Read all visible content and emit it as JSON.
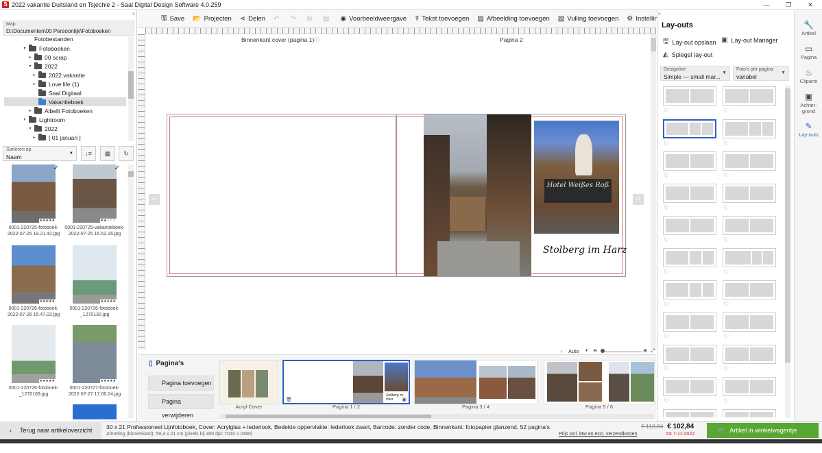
{
  "window": {
    "title": "2022 vakantie Duitsland en Tsjechie 2 - Saal Digital Design Software 4.0.259",
    "logo": "S",
    "min": "—",
    "max": "❐",
    "close": "✕"
  },
  "left": {
    "map_label": "Map",
    "map_path": "D:\\Documenten\\00 Persoonlijk\\Fotoboeken",
    "tree": [
      {
        "label": "Fotobestanden",
        "arrow": "",
        "folder": false
      },
      {
        "label": "Fotoboeken",
        "arrow": "▾",
        "folder": true
      },
      {
        "label": "00 scrap",
        "arrow": "▸",
        "folder": true
      },
      {
        "label": "2022",
        "arrow": "▾",
        "folder": true
      },
      {
        "label": "2022 vakantie",
        "arrow": "▸",
        "folder": true
      },
      {
        "label": "Love life (1)",
        "arrow": "▸",
        "folder": true
      },
      {
        "label": "Saal Digitaal",
        "arrow": "",
        "folder": true
      },
      {
        "label": "Vakantieboek",
        "arrow": "",
        "folder": true
      },
      {
        "label": "Albelli Fotoboeken",
        "arrow": "▸",
        "folder": true
      },
      {
        "label": "Lightroom",
        "arrow": "▾",
        "folder": true
      },
      {
        "label": "2022",
        "arrow": "▾",
        "folder": true
      },
      {
        "label": "[ 01 januari ]",
        "arrow": "▸",
        "folder": true
      }
    ],
    "sort_label": "Sorteren op",
    "sort_value": "Naam",
    "photos": [
      {
        "caption": "0001-220725-fotoboek-2022-07-25 19.21.42.jpg",
        "stars": "★★★★★",
        "check": "✓"
      },
      {
        "caption": "0001-220725-vakantieboek-2022-07-25 16.52.16.jpg",
        "stars": "★★☆☆☆",
        "check": "✓"
      },
      {
        "caption": "0001-220726-fotoboek-2022-07-26 15.47.02.jpg",
        "stars": "★★★★★",
        "check": ""
      },
      {
        "caption": "0001-220726-fotoboek-_1270130.jpg",
        "stars": "★★★★★",
        "check": ""
      },
      {
        "caption": "0001-220726-fotoboek-_1270169.jpg",
        "stars": "★★★★★",
        "check": ""
      },
      {
        "caption": "0001-220727-fotoboek-2022-07-27 17.06.24.jpg",
        "stars": "★★★★★",
        "check": ""
      }
    ]
  },
  "toolbar": {
    "save": "Save",
    "projects": "Projecten",
    "share": "Delen",
    "preview": "Voorbeeldweergave",
    "add_text": "Tekst toevoegen",
    "add_image": "Afbeelding toevoegen",
    "add_fill": "Vulling toevoegen",
    "settings": "Instellingen"
  },
  "canvas": {
    "left_page": "Binnenkant cover (pagina 1)",
    "right_page": "Pagina 2",
    "caption": "Stolberg im Harz",
    "sign_text": "Hotel Weißes Roß",
    "zoom": "Auto"
  },
  "pages": {
    "title": "Pagina's",
    "add": "Pagina toevoegen",
    "remove": "Pagina verwijderen",
    "thumbs": [
      {
        "label": "Acryl-Cover"
      },
      {
        "label": "Pagina 1 / 2"
      },
      {
        "label": "Pagina 3 / 4"
      },
      {
        "label": "Pagina 5 / 6"
      }
    ]
  },
  "right": {
    "title": "Lay-outs",
    "save_layout": "Lay-out opslaan",
    "manager": "Lay-out Manager",
    "mirror": "Spiegel lay-out",
    "designline_label": "Designline",
    "designline_value": "Simple — small mar...",
    "photos_label": "Foto's per pagina",
    "photos_value": "variabel"
  },
  "side": [
    {
      "label": "Artikel",
      "icon": "🔧"
    },
    {
      "label": "Pagina",
      "icon": "▭"
    },
    {
      "label": "Cliparts",
      "icon": "♨"
    },
    {
      "label": "Achter-grond",
      "icon": "▣"
    },
    {
      "label": "Lay-outs",
      "icon": "✎"
    }
  ],
  "status": {
    "back": "Terug naar artikeloverzicht",
    "product": "30 x 21 Professioneel Lijnfotoboek, Cover: Acrylglas + lederlook, Bedekte oppervlakte: lederlook zwart, Barcode: zonder code, Binnenkant: fotopapier glanzend, 52 pagina's",
    "dimensions": "Afmeting (binnenkant): 59,4 x 21 cm (pixels bij 300 dpi: 7016 x 2480)",
    "old_price": "€ 112,84",
    "new_price": "€ 102,84",
    "vat": "Prijs incl. btw en excl. verzendkosten",
    "until": "tot 7-11-2022",
    "cart": "Artikel in winkelwagentje plaatsen"
  },
  "colors": {
    "accent": "#2f60c0",
    "cart": "#58a732",
    "price_red": "#d42020"
  }
}
